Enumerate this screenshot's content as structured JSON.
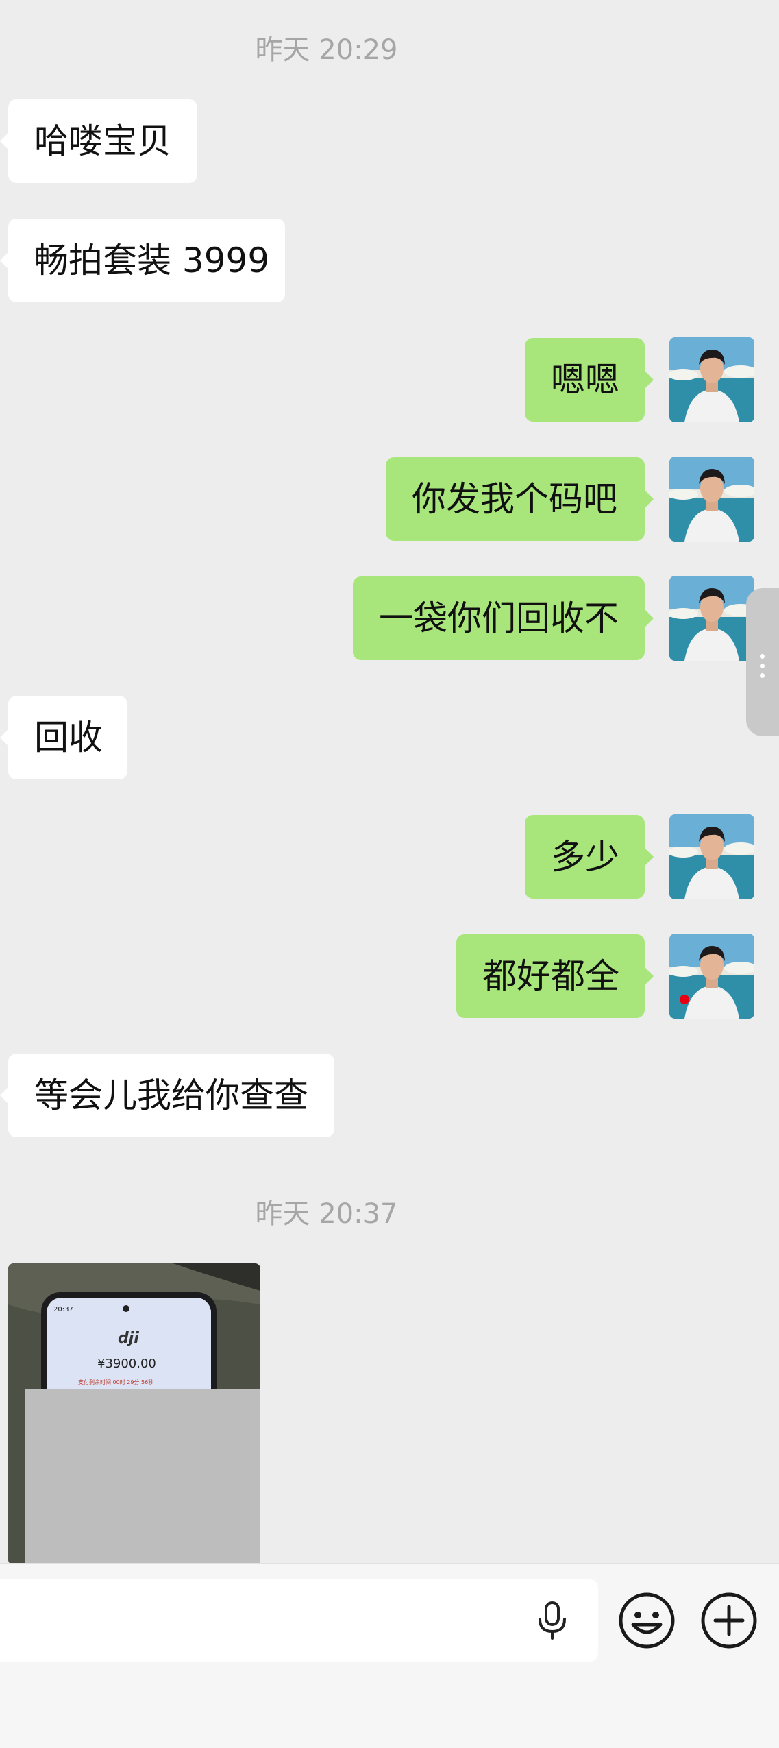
{
  "timestamps": [
    "昨天 20:29",
    "昨天 20:37"
  ],
  "messages": [
    {
      "sender": "other",
      "text": "哈喽宝贝"
    },
    {
      "sender": "other",
      "text": "畅拍套装 3999"
    },
    {
      "sender": "me",
      "text": "嗯嗯"
    },
    {
      "sender": "me",
      "text": "你发我个码吧"
    },
    {
      "sender": "me",
      "text": "一袋你们回收不"
    },
    {
      "sender": "other",
      "text": "回收"
    },
    {
      "sender": "me",
      "text": "多少"
    },
    {
      "sender": "me",
      "text": "都好都全"
    },
    {
      "sender": "other",
      "text": "等会儿我给你查查"
    }
  ],
  "image_message": {
    "phone_time": "20:37",
    "brand": "dji",
    "price": "¥3900.00",
    "countdown": "支付剩余时间 00时 29分 56秒"
  },
  "input": {
    "placeholder": ""
  },
  "icons": {
    "voice": "microphone-icon",
    "emoji": "emoji-icon",
    "more": "plus-icon"
  },
  "colors": {
    "background": "#ededed",
    "outgoing_bubble": "#a8e57a",
    "incoming_bubble": "#ffffff",
    "timestamp": "#a6a6a6"
  }
}
